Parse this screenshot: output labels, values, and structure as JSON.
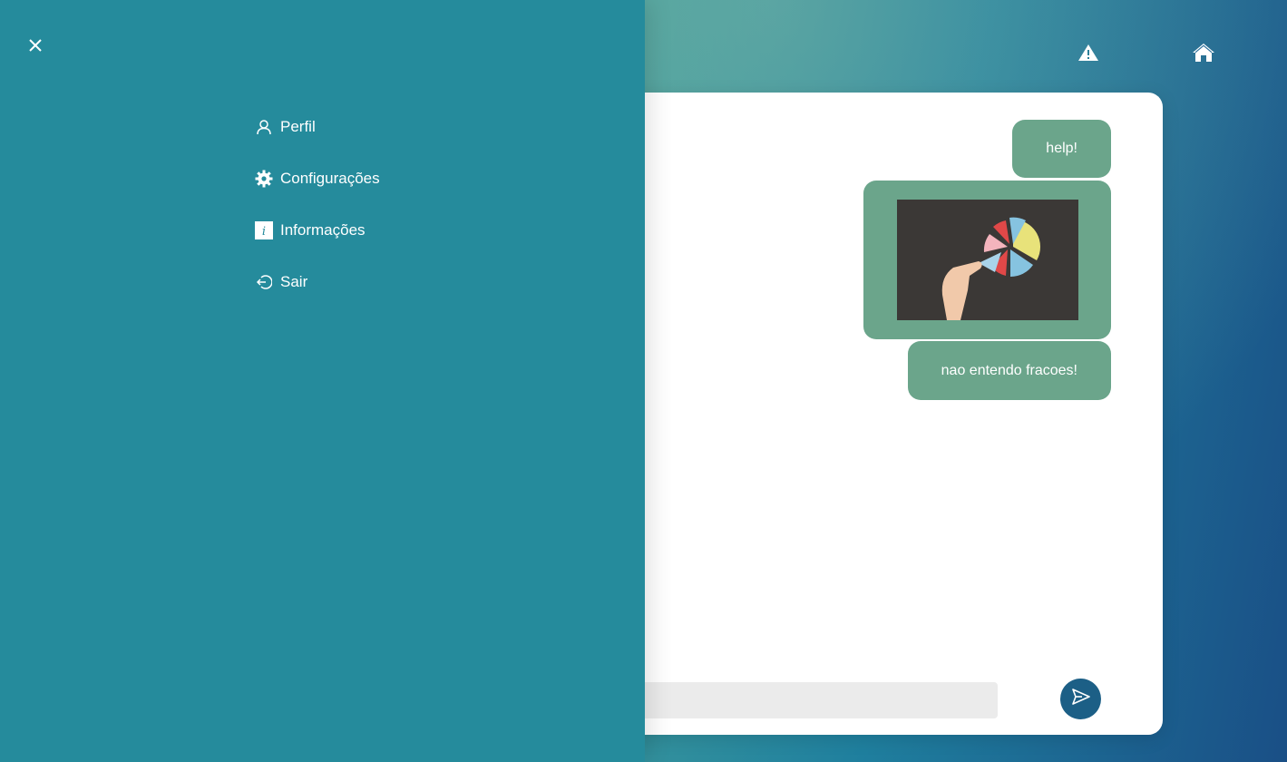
{
  "header": {
    "warning_icon": "warning-icon",
    "home_icon": "home-icon"
  },
  "chat": {
    "messages": [
      {
        "type": "text",
        "text": "help!"
      },
      {
        "type": "image",
        "description_icon": "fraction-pie-photo"
      },
      {
        "type": "text",
        "text": "nao entendo fracoes!"
      }
    ],
    "input": {
      "value": "",
      "placeholder": ""
    },
    "send_icon": "send-icon"
  },
  "side_menu": {
    "close_icon": "close-icon",
    "items": [
      {
        "label": "Perfil",
        "icon": "user-icon"
      },
      {
        "label": "Configurações",
        "icon": "gear-icon"
      },
      {
        "label": "Informações",
        "icon": "info-icon"
      },
      {
        "label": "Sair",
        "icon": "logout-icon"
      }
    ]
  },
  "colors": {
    "panel": "#258b9c",
    "bubble": "#6ba58b",
    "send_button": "#1c5f86"
  }
}
